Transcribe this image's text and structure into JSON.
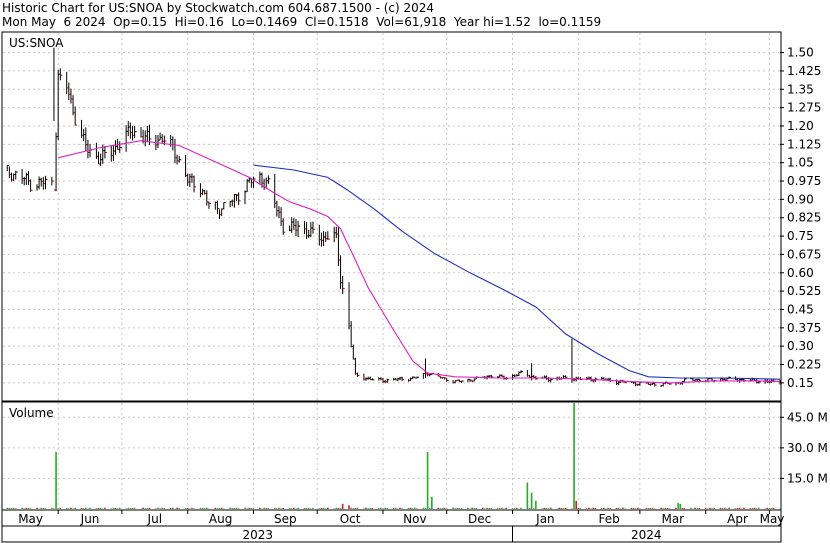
{
  "header": {
    "line1": "Historic Chart for US:SNOA by Stockwatch.com 604.687.1500 - (c) 2024",
    "line2": "Mon May  6 2024  Op=0.15  Hi=0.16  Lo=0.1469  Cl=0.1518  Vol=61,918  Year hi=1.52  lo=0.1159"
  },
  "colors": {
    "background": "#ffffff",
    "grid": "#c8c8c8",
    "bar_up": "#000000",
    "bar_down": "#b00000",
    "ma_short": "#e020c0",
    "ma_long": "#2030c0",
    "vol_up": "#20b020",
    "vol_down": "#d02020"
  },
  "chart_data": [
    {
      "type": "line",
      "title": "US:SNOA",
      "ylim": [
        0.08,
        1.58
      ],
      "ytick_labels": [
        "1.50",
        "1.425",
        "1.35",
        "1.275",
        "1.20",
        "1.125",
        "1.05",
        "0.975",
        "0.90",
        "0.825",
        "0.75",
        "0.675",
        "0.60",
        "0.525",
        "0.45",
        "0.375",
        "0.30",
        "0.225",
        "0.15"
      ],
      "ytick_values": [
        1.5,
        1.425,
        1.35,
        1.275,
        1.2,
        1.125,
        1.05,
        0.975,
        0.9,
        0.825,
        0.75,
        0.675,
        0.6,
        0.525,
        0.45,
        0.375,
        0.3,
        0.225,
        0.15
      ],
      "x_range": [
        "2023-05-06",
        "2024-05-06"
      ],
      "month_labels": [
        {
          "label": "May",
          "date": "2023-05-01"
        },
        {
          "label": "Jun",
          "date": "2023-06-01"
        },
        {
          "label": "Jul",
          "date": "2023-07-01"
        },
        {
          "label": "Aug",
          "date": "2023-08-01"
        },
        {
          "label": "Sep",
          "date": "2023-09-01"
        },
        {
          "label": "Oct",
          "date": "2023-10-01"
        },
        {
          "label": "Nov",
          "date": "2023-11-01"
        },
        {
          "label": "Dec",
          "date": "2023-12-01"
        },
        {
          "label": "Jan",
          "date": "2024-01-01"
        },
        {
          "label": "Feb",
          "date": "2024-02-01"
        },
        {
          "label": "Mar",
          "date": "2024-03-01"
        },
        {
          "label": "Apr",
          "date": "2024-04-01"
        },
        {
          "label": "May",
          "date": "2024-05-01"
        }
      ],
      "year_labels": [
        {
          "label": "2023",
          "date": "2023-09-01"
        },
        {
          "label": "2024",
          "date": "2024-03-01"
        }
      ],
      "price_anchors": [
        [
          "2023-05-06",
          1.02
        ],
        [
          "2023-05-15",
          0.99
        ],
        [
          "2023-05-20",
          0.96
        ],
        [
          "2023-05-25",
          0.97
        ],
        [
          "2023-05-30",
          0.96
        ],
        [
          "2023-06-01",
          1.4
        ],
        [
          "2023-06-05",
          1.36
        ],
        [
          "2023-06-10",
          1.2
        ],
        [
          "2023-06-15",
          1.1
        ],
        [
          "2023-06-20",
          1.07
        ],
        [
          "2023-06-25",
          1.08
        ],
        [
          "2023-06-30",
          1.13
        ],
        [
          "2023-07-05",
          1.18
        ],
        [
          "2023-07-10",
          1.16
        ],
        [
          "2023-07-15",
          1.14
        ],
        [
          "2023-07-20",
          1.15
        ],
        [
          "2023-07-25",
          1.11
        ],
        [
          "2023-08-01",
          0.98
        ],
        [
          "2023-08-07",
          0.95
        ],
        [
          "2023-08-12",
          0.86
        ],
        [
          "2023-08-18",
          0.87
        ],
        [
          "2023-08-24",
          0.91
        ],
        [
          "2023-08-30",
          0.97
        ],
        [
          "2023-09-04",
          0.99
        ],
        [
          "2023-09-08",
          0.96
        ],
        [
          "2023-09-12",
          0.86
        ],
        [
          "2023-09-16",
          0.77
        ],
        [
          "2023-09-22",
          0.79
        ],
        [
          "2023-09-28",
          0.76
        ],
        [
          "2023-10-04",
          0.74
        ],
        [
          "2023-10-08",
          0.77
        ],
        [
          "2023-10-10",
          0.73
        ],
        [
          "2023-10-12",
          0.58
        ],
        [
          "2023-10-14",
          0.49
        ],
        [
          "2023-10-16",
          0.38
        ],
        [
          "2023-10-19",
          0.18
        ],
        [
          "2023-10-26",
          0.165
        ],
        [
          "2023-11-02",
          0.16
        ],
        [
          "2023-11-09",
          0.165
        ],
        [
          "2023-11-16",
          0.17
        ],
        [
          "2023-11-22",
          0.19
        ],
        [
          "2023-11-27",
          0.175
        ],
        [
          "2023-12-05",
          0.155
        ],
        [
          "2023-12-14",
          0.165
        ],
        [
          "2023-12-22",
          0.18
        ],
        [
          "2023-12-29",
          0.17
        ],
        [
          "2024-01-05",
          0.19
        ],
        [
          "2024-01-12",
          0.17
        ],
        [
          "2024-01-19",
          0.165
        ],
        [
          "2024-01-26",
          0.17
        ],
        [
          "2024-02-02",
          0.165
        ],
        [
          "2024-02-12",
          0.165
        ],
        [
          "2024-02-19",
          0.155
        ],
        [
          "2024-02-26",
          0.15
        ],
        [
          "2024-03-04",
          0.145
        ],
        [
          "2024-03-11",
          0.145
        ],
        [
          "2024-03-18",
          0.15
        ],
        [
          "2024-03-25",
          0.165
        ],
        [
          "2024-04-01",
          0.16
        ],
        [
          "2024-04-08",
          0.165
        ],
        [
          "2024-04-15",
          0.165
        ],
        [
          "2024-04-22",
          0.16
        ],
        [
          "2024-04-29",
          0.155
        ],
        [
          "2024-05-06",
          0.152
        ]
      ],
      "spikes": [
        {
          "date": "2023-05-30",
          "high": 1.52,
          "low": 1.22
        },
        {
          "date": "2023-05-14",
          "high": 1.0,
          "low": 0.78
        },
        {
          "date": "2023-11-21",
          "high": 0.25,
          "low": 0.17
        },
        {
          "date": "2024-01-10",
          "high": 0.23,
          "low": 0.16
        },
        {
          "date": "2024-01-29",
          "high": 0.33,
          "low": 0.15
        }
      ],
      "ma_short": [
        [
          "2023-06-01",
          1.07
        ],
        [
          "2023-06-20",
          1.11
        ],
        [
          "2023-07-10",
          1.14
        ],
        [
          "2023-07-28",
          1.12
        ],
        [
          "2023-08-15",
          1.05
        ],
        [
          "2023-08-30",
          0.99
        ],
        [
          "2023-09-10",
          0.93
        ],
        [
          "2023-09-18",
          0.89
        ],
        [
          "2023-09-28",
          0.86
        ],
        [
          "2023-10-06",
          0.83
        ],
        [
          "2023-10-12",
          0.78
        ],
        [
          "2023-10-18",
          0.67
        ],
        [
          "2023-10-25",
          0.54
        ],
        [
          "2023-11-05",
          0.38
        ],
        [
          "2023-11-15",
          0.24
        ],
        [
          "2023-11-22",
          0.19
        ],
        [
          "2023-12-05",
          0.175
        ],
        [
          "2023-12-25",
          0.17
        ],
        [
          "2024-01-15",
          0.17
        ],
        [
          "2024-02-05",
          0.165
        ],
        [
          "2024-02-26",
          0.155
        ],
        [
          "2024-03-15",
          0.15
        ],
        [
          "2024-04-05",
          0.158
        ],
        [
          "2024-04-25",
          0.158
        ],
        [
          "2024-05-06",
          0.155
        ]
      ],
      "ma_long": [
        [
          "2023-09-01",
          1.04
        ],
        [
          "2023-09-20",
          1.02
        ],
        [
          "2023-10-06",
          0.99
        ],
        [
          "2023-10-15",
          0.94
        ],
        [
          "2023-10-28",
          0.86
        ],
        [
          "2023-11-10",
          0.77
        ],
        [
          "2023-11-25",
          0.68
        ],
        [
          "2023-12-12",
          0.6
        ],
        [
          "2023-12-28",
          0.53
        ],
        [
          "2024-01-12",
          0.46
        ],
        [
          "2024-01-26",
          0.35
        ],
        [
          "2024-02-10",
          0.27
        ],
        [
          "2024-02-25",
          0.2
        ],
        [
          "2024-03-05",
          0.175
        ],
        [
          "2024-03-20",
          0.17
        ],
        [
          "2024-04-10",
          0.17
        ],
        [
          "2024-05-06",
          0.165
        ]
      ]
    },
    {
      "type": "bar",
      "title": "Volume",
      "ylim": [
        0,
        52
      ],
      "ytick_labels": [
        "45.0 M",
        "30.0 M",
        "15.0 M"
      ],
      "ytick_values": [
        45,
        30,
        15
      ],
      "volume_anchors": [
        {
          "date": "2023-05-31",
          "value": 28,
          "up": true
        },
        {
          "date": "2023-10-13",
          "value": 2.5,
          "up": false
        },
        {
          "date": "2023-10-16",
          "value": 1.8,
          "up": false
        },
        {
          "date": "2023-11-22",
          "value": 28,
          "up": true
        },
        {
          "date": "2023-11-24",
          "value": 6,
          "up": true
        },
        {
          "date": "2024-01-08",
          "value": 13,
          "up": true
        },
        {
          "date": "2024-01-10",
          "value": 8,
          "up": true
        },
        {
          "date": "2024-01-12",
          "value": 4,
          "up": true
        },
        {
          "date": "2024-01-30",
          "value": 53,
          "up": true
        },
        {
          "date": "2024-01-31",
          "value": 4,
          "up": false
        },
        {
          "date": "2024-03-19",
          "value": 3,
          "up": true
        },
        {
          "date": "2024-03-20",
          "value": 2.5,
          "up": true
        }
      ]
    }
  ]
}
